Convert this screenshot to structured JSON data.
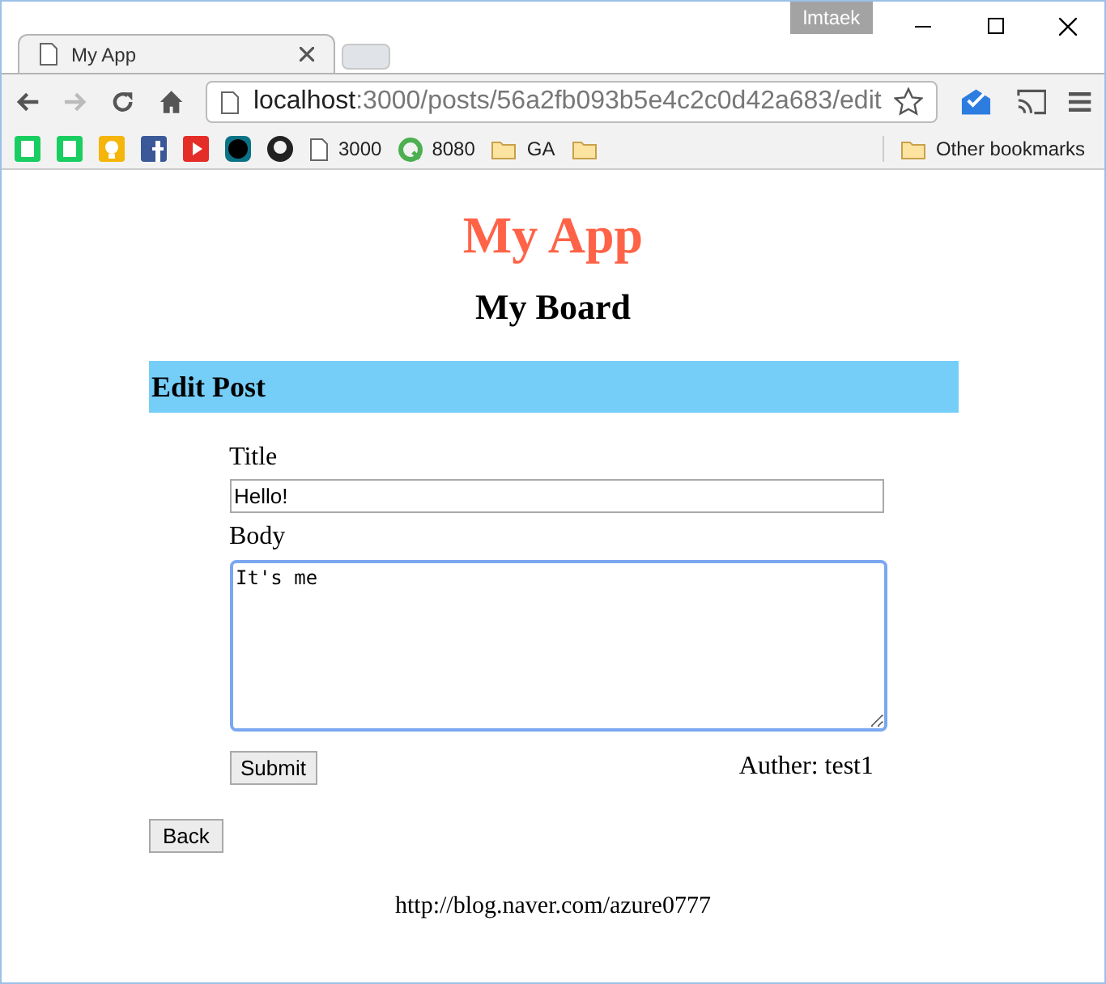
{
  "browser": {
    "profile": "lmtaek",
    "tab": {
      "title": "My App"
    },
    "url": {
      "host": "localhost",
      "path": ":3000/posts/56a2fb093b5e4c2c0d42a683/edit"
    },
    "bookmarks": [
      {
        "kind": "page",
        "label": "3000"
      },
      {
        "kind": "site",
        "label": "8080"
      },
      {
        "kind": "folder",
        "label": "GA"
      },
      {
        "kind": "folder"
      }
    ],
    "other_bookmarks": "Other bookmarks"
  },
  "page": {
    "app_title": "My App",
    "board_title": "My Board",
    "section_title": "Edit Post",
    "form": {
      "title_label": "Title",
      "title_value": "Hello!",
      "body_label": "Body",
      "body_value": "It's me",
      "body_focused": true,
      "submit": "Submit",
      "author": "Auther: test1"
    },
    "back": "Back",
    "footer": "http://blog.naver.com/azure0777"
  }
}
